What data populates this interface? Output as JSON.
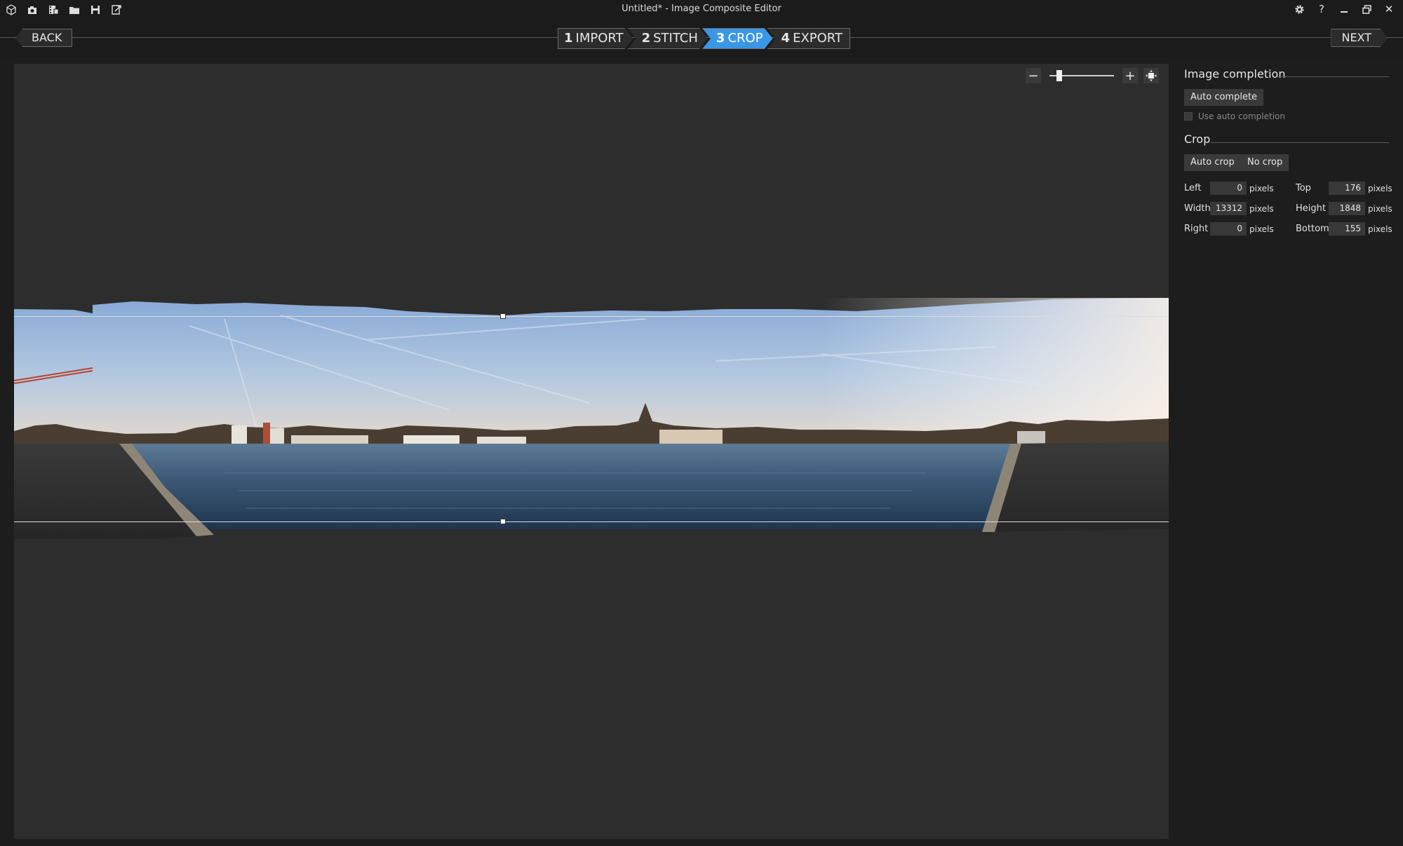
{
  "titlebar": {
    "title": "Untitled* - Image Composite Editor",
    "icons": [
      "new-project-icon",
      "new-panorama-from-images-icon",
      "new-panorama-from-video-icon",
      "open-icon",
      "save-icon",
      "export-icon"
    ],
    "window_controls": [
      "settings-icon",
      "help-icon",
      "minimize-icon",
      "restore-icon",
      "close-icon"
    ],
    "help_glyph": "?",
    "close_glyph": "✕"
  },
  "nav": {
    "back_label": "BACK",
    "next_label": "NEXT",
    "steps": [
      {
        "num": "1",
        "label": "IMPORT",
        "active": false
      },
      {
        "num": "2",
        "label": "STITCH",
        "active": false
      },
      {
        "num": "3",
        "label": "CROP",
        "active": true
      },
      {
        "num": "4",
        "label": "EXPORT",
        "active": false
      }
    ],
    "active_color": "#3a97e6"
  },
  "zoom": {
    "minus_glyph": "−",
    "plus_glyph": "+",
    "level_fraction": 0.12
  },
  "panel": {
    "image_completion": {
      "title": "Image completion",
      "auto_complete_label": "Auto complete",
      "use_auto_completion_label": "Use auto completion",
      "use_auto_completion_checked": false
    },
    "crop": {
      "title": "Crop",
      "auto_crop_label": "Auto crop",
      "no_crop_label": "No crop",
      "fields": {
        "left": {
          "label": "Left",
          "value": "0",
          "unit": "pixels"
        },
        "top": {
          "label": "Top",
          "value": "176",
          "unit": "pixels"
        },
        "width": {
          "label": "Width",
          "value": "13312",
          "unit": "pixels"
        },
        "height": {
          "label": "Height",
          "value": "1848",
          "unit": "pixels"
        },
        "right": {
          "label": "Right",
          "value": "0",
          "unit": "pixels"
        },
        "bottom": {
          "label": "Bottom",
          "value": "155",
          "unit": "pixels"
        }
      }
    }
  }
}
